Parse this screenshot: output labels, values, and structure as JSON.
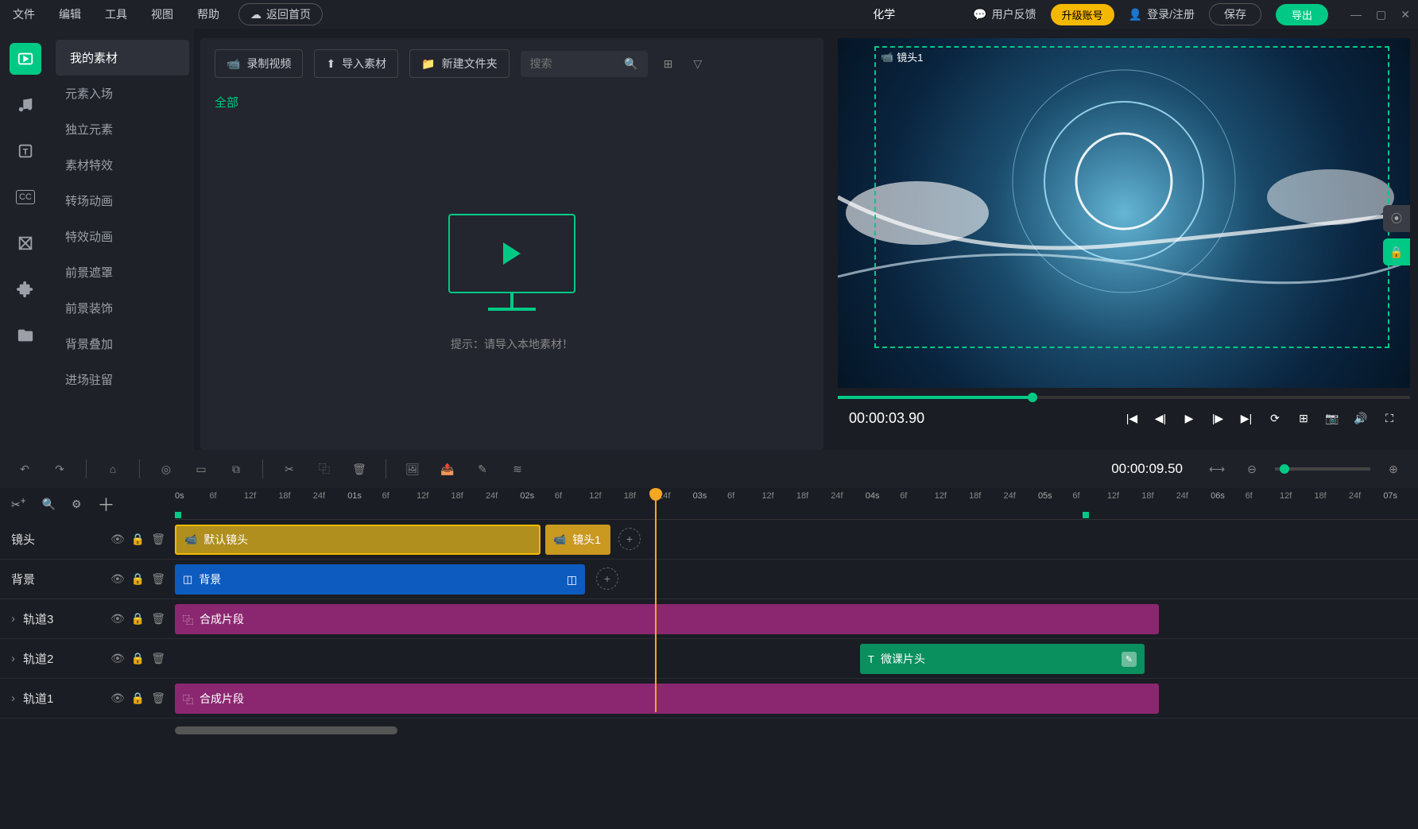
{
  "menu": {
    "file": "文件",
    "edit": "编辑",
    "tool": "工具",
    "view": "视图",
    "help": "帮助",
    "home": "返回首页"
  },
  "title": "化学",
  "header": {
    "feedback": "用户反馈",
    "upgrade": "升级账号",
    "login": "登录/注册",
    "save": "保存",
    "export": "导出"
  },
  "sidebar": {
    "items": [
      "我的素材",
      "元素入场",
      "独立元素",
      "素材特效",
      "转场动画",
      "特效动画",
      "前景遮罩",
      "前景装饰",
      "背景叠加",
      "进场驻留"
    ]
  },
  "toolbar": {
    "record": "录制视频",
    "import": "导入素材",
    "newfolder": "新建文件夹",
    "search_placeholder": "搜索",
    "all": "全部"
  },
  "empty_hint": "提示：请导入本地素材！",
  "preview": {
    "selection_label": "镜头1",
    "time": "00:00:03.90"
  },
  "tooltime": "00:00:09.50",
  "ruler": [
    "0s",
    "6f",
    "12f",
    "18f",
    "24f",
    "01s",
    "6f",
    "12f",
    "18f",
    "24f",
    "02s",
    "6f",
    "12f",
    "18f",
    "24f",
    "03s",
    "6f",
    "12f",
    "18f",
    "24f",
    "04s",
    "6f",
    "12f",
    "18f",
    "24f",
    "05s",
    "6f",
    "12f",
    "18f",
    "24f",
    "06s",
    "6f",
    "12f",
    "18f",
    "24f",
    "07s"
  ],
  "tracks": {
    "shot": {
      "label": "镜头",
      "clip1": "默认镜头",
      "clip2": "镜头1"
    },
    "bg": {
      "label": "背景",
      "clip1": "背景"
    },
    "t3": {
      "label": "轨道3",
      "clip1": "合成片段"
    },
    "t2": {
      "label": "轨道2",
      "clip1": "微课片头"
    },
    "t1": {
      "label": "轨道1",
      "clip1": "合成片段"
    }
  }
}
